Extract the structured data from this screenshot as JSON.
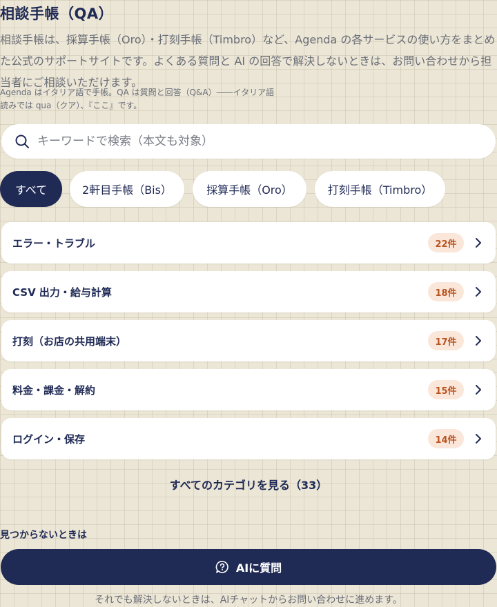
{
  "header": {
    "title": "相談手帳（QA）",
    "description": "相談手帳は、採算手帳（Oro）・打刻手帳（Timbro）など、Agenda の各サービスの使い方をまとめた公式のサポートサイトです。よくある質問と AI の回答で解決しないときは、お問い合わせから担当者にご相談いただけます。",
    "note": "Agenda はイタリア語で手帳。QA は質問と回答（Q&A）――イタリア語読みでは qua（クア）、『ここ』です。"
  },
  "search": {
    "placeholder": "キーワードで検索（本文も対象）",
    "icon": "search-icon"
  },
  "filters": [
    {
      "label": "すべて",
      "active": true
    },
    {
      "label": "2軒目手帳（Bis）",
      "active": false
    },
    {
      "label": "採算手帳（Oro）",
      "active": false
    },
    {
      "label": "打刻手帳（Timbro）",
      "active": false
    }
  ],
  "categories": [
    {
      "label": "エラー・トラブル",
      "count": "22件"
    },
    {
      "label": "CSV 出力・給与計算",
      "count": "18件"
    },
    {
      "label": "打刻（お店の共用端末）",
      "count": "17件"
    },
    {
      "label": "料金・課金・解約",
      "count": "15件"
    },
    {
      "label": "ログイン・保存",
      "count": "14件"
    }
  ],
  "see_all_label": "すべてのカテゴリを見る（33）",
  "help": {
    "section_label": "見つからないときは",
    "ai_button_label": "AIに質問",
    "footer_note": "それでも解決しないときは、AIチャットからお問い合わせに進めます。"
  },
  "colors": {
    "primary": "#1f2a55",
    "background": "#ece6d6",
    "badge_bg": "#fbe6da",
    "badge_text": "#b8541f"
  }
}
